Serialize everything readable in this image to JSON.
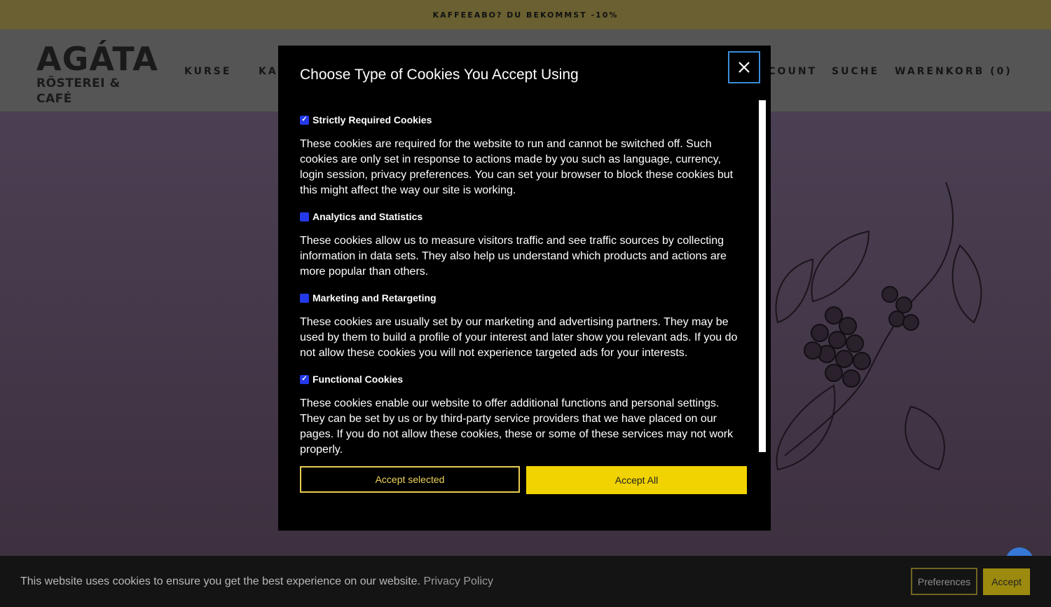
{
  "announcement": "KAFFEEABO? DU BEKOMMST -10%",
  "logo": {
    "line1": "AGÁTA",
    "line2": "RÖSTEREI & CAFÉ"
  },
  "nav": {
    "kurse": "KURSE",
    "ka": "KA",
    "account": "CCOUNT",
    "suche": "SUCHE",
    "warenkorb": "WARENKORB (0)"
  },
  "modal": {
    "title": "Choose Type of Cookies You Accept Using",
    "sections": [
      {
        "label": "Strictly Required Cookies",
        "checked": true,
        "text": "These cookies are required for the website to run and cannot be switched off. Such cookies are only set in response to actions made by you such as language, currency, login session, privacy preferences. You can set your browser to block these cookies but this might affect the way our site is working."
      },
      {
        "label": "Analytics and Statistics",
        "checked": false,
        "text": "These cookies allow us to measure visitors traffic and see traffic sources by collecting information in data sets. They also help us understand which products and actions are more popular than others."
      },
      {
        "label": "Marketing and Retargeting",
        "checked": false,
        "text": "These cookies are usually set by our marketing and advertising partners. They may be used by them to build a profile of your interest and later show you relevant ads. If you do not allow these cookies you will not experience targeted ads for your interests."
      },
      {
        "label": "Functional Cookies",
        "checked": true,
        "text": "These cookies enable our website to offer additional functions and personal settings. They can be set by us or by third-party service providers that we have placed on our pages. If you do not allow these cookies, these or some of these services may not work properly."
      }
    ],
    "accept_selected": "Accept selected",
    "accept_all": "Accept All"
  },
  "cookie_bar": {
    "text": "This website uses cookies to ensure you get the best experience on our website.",
    "privacy_link": "Privacy Policy",
    "preferences": "Preferences",
    "accept": "Accept"
  },
  "colors": {
    "announce_bg": "#6a6031",
    "accent_yellow": "#f0d300",
    "checkbox_blue": "#2439e8",
    "focus_ring": "#3b8bd6"
  }
}
